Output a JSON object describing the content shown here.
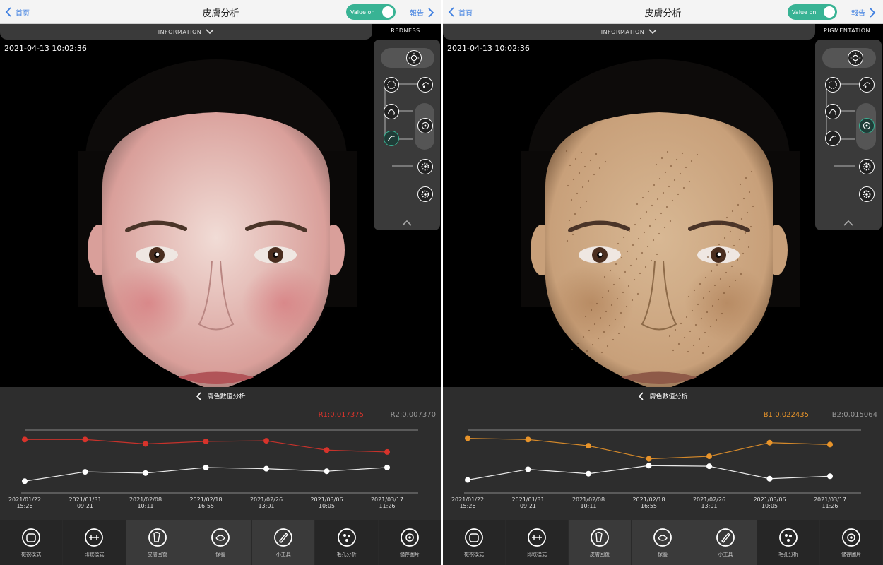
{
  "screens": [
    {
      "back_label": "首页",
      "title": "皮膚分析",
      "toggle_label": "Value on",
      "report_label": "報告",
      "info_tab": "INFORMATION",
      "mode_label": "REDNESS",
      "timestamp": "2021-04-13  10:02:36",
      "chart_title": "膚色數值分析",
      "series1_label": "R1:0.017375",
      "series2_label": "R2:0.007370",
      "series1_color": "#d8332b",
      "skin_tint": "#d99f9a",
      "chart_data": {
        "type": "line",
        "x": [
          "2021/01/22 15:26",
          "2021/01/31 09:21",
          "2021/02/08 10:11",
          "2021/02/18 16:55",
          "2021/02/26 13:01",
          "2021/03/06 10:05",
          "2021/03/17 11:26"
        ],
        "series": [
          {
            "name": "R1",
            "values": [
              0.86,
              0.86,
              0.79,
              0.83,
              0.84,
              0.69,
              0.66
            ]
          },
          {
            "name": "R2",
            "values": [
              0.19,
              0.34,
              0.32,
              0.41,
              0.39,
              0.35,
              0.41
            ]
          }
        ],
        "ylim": [
          0,
          1
        ],
        "grid": false
      },
      "active_mode_index": 5
    },
    {
      "back_label": "首頁",
      "title": "皮膚分析",
      "toggle_label": "Value on",
      "report_label": "報告",
      "info_tab": "INFORMATION",
      "mode_label": "PIGMENTATION",
      "timestamp": "2021-04-13  10:02:36",
      "chart_title": "膚色數值分析",
      "series1_label": "B1:0.022435",
      "series2_label": "B2:0.015064",
      "series1_color": "#e8942a",
      "skin_tint": "#c8a07a",
      "chart_data": {
        "type": "line",
        "x": [
          "2021/01/22 15:26",
          "2021/01/31 09:21",
          "2021/02/08 10:11",
          "2021/02/18 16:55",
          "2021/02/26 13:01",
          "2021/03/06 10:05",
          "2021/03/17 11:26"
        ],
        "series": [
          {
            "name": "B1",
            "values": [
              0.88,
              0.86,
              0.76,
              0.55,
              0.59,
              0.81,
              0.78
            ]
          },
          {
            "name": "B2",
            "values": [
              0.21,
              0.38,
              0.31,
              0.44,
              0.43,
              0.23,
              0.27
            ]
          }
        ],
        "ylim": [
          0,
          1
        ],
        "grid": false
      },
      "active_mode_index": 4
    }
  ],
  "nav_items": [
    {
      "label": "檢視模式",
      "icon": "face-scan-icon"
    },
    {
      "label": "比較模式",
      "icon": "compare-icon"
    },
    {
      "label": "皮膚回復",
      "icon": "skin-recovery-icon"
    },
    {
      "label": "保養",
      "icon": "care-icon"
    },
    {
      "label": "小工具",
      "icon": "pen-tool-icon"
    },
    {
      "label": "毛孔分析",
      "icon": "pore-analysis-icon"
    },
    {
      "label": "儲存圖片",
      "icon": "save-image-icon"
    }
  ],
  "mode_icons": [
    "light-mode-icon",
    "texture-icon",
    "pore-icon",
    "spot-icon",
    "uv-icon",
    "redness-icon",
    "gear-icon-a",
    "gear-icon-b"
  ]
}
